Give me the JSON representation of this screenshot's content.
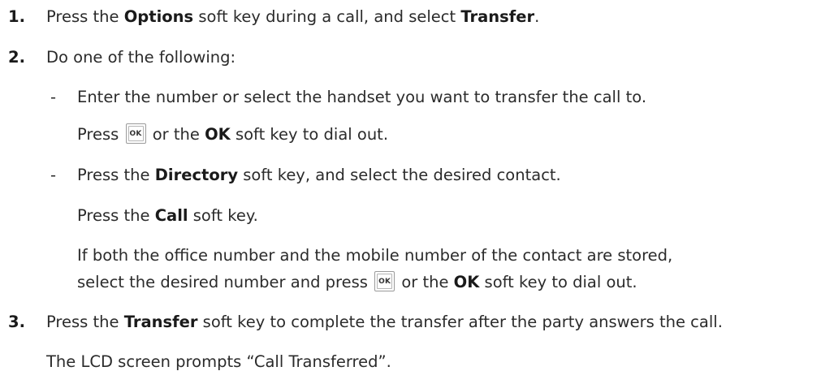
{
  "steps": [
    {
      "number": "1.",
      "text_before": "Press the ",
      "bold1": "Options",
      "text_mid": " soft key during a call, and select ",
      "bold2": "Transfer",
      "text_after": "."
    },
    {
      "number": "2.",
      "text": "Do one of the following:",
      "options": [
        {
          "bullet": "-",
          "line1": "Enter the number or select the handset you want to transfer the call to.",
          "line2_before": "Press ",
          "line2_mid": " or the ",
          "line2_bold": "OK",
          "line2_after": " soft key to dial out."
        },
        {
          "bullet": "-",
          "line1_before": "Press the ",
          "line1_bold": "Directory",
          "line1_after": " soft key, and select the desired contact.",
          "line2_before": "Press the ",
          "line2_bold": "Call",
          "line2_after": " soft key.",
          "line3": "If both the office number and the mobile number of the contact are stored,",
          "line4_before": "select the desired number and press ",
          "line4_mid": " or the ",
          "line4_bold": "OK",
          "line4_after": " soft key to dial out."
        }
      ]
    },
    {
      "number": "3.",
      "text_before": "Press the ",
      "bold": "Transfer",
      "text_after": " soft key to complete the transfer after the party answers the call.",
      "note": "The LCD screen prompts “Call Transferred”."
    }
  ],
  "ok_key": {
    "label": "OK",
    "icon": "ok-key-icon"
  }
}
